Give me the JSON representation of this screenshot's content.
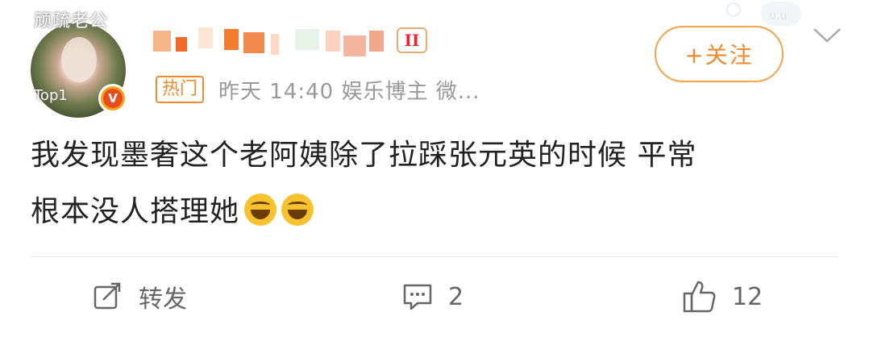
{
  "header": {
    "avatar_overlay_text": "顽疏老公",
    "avatar_tag": "Top1",
    "verified_badge": "V",
    "vip_label": "II",
    "hot_tag": "热门",
    "meta": "昨天 14:40 娱乐博主 微...",
    "follow_label": "+关注"
  },
  "post": {
    "text_line1": "我发现墨奢这个老阿姨除了拉踩张元英的时候 平常",
    "text_line2": "根本没人搭理她"
  },
  "actions": {
    "repost_label": "转发",
    "comment_count": "2",
    "like_count": "12"
  },
  "colors": {
    "accent": "#f08a2b",
    "meta_gray": "#999999"
  }
}
